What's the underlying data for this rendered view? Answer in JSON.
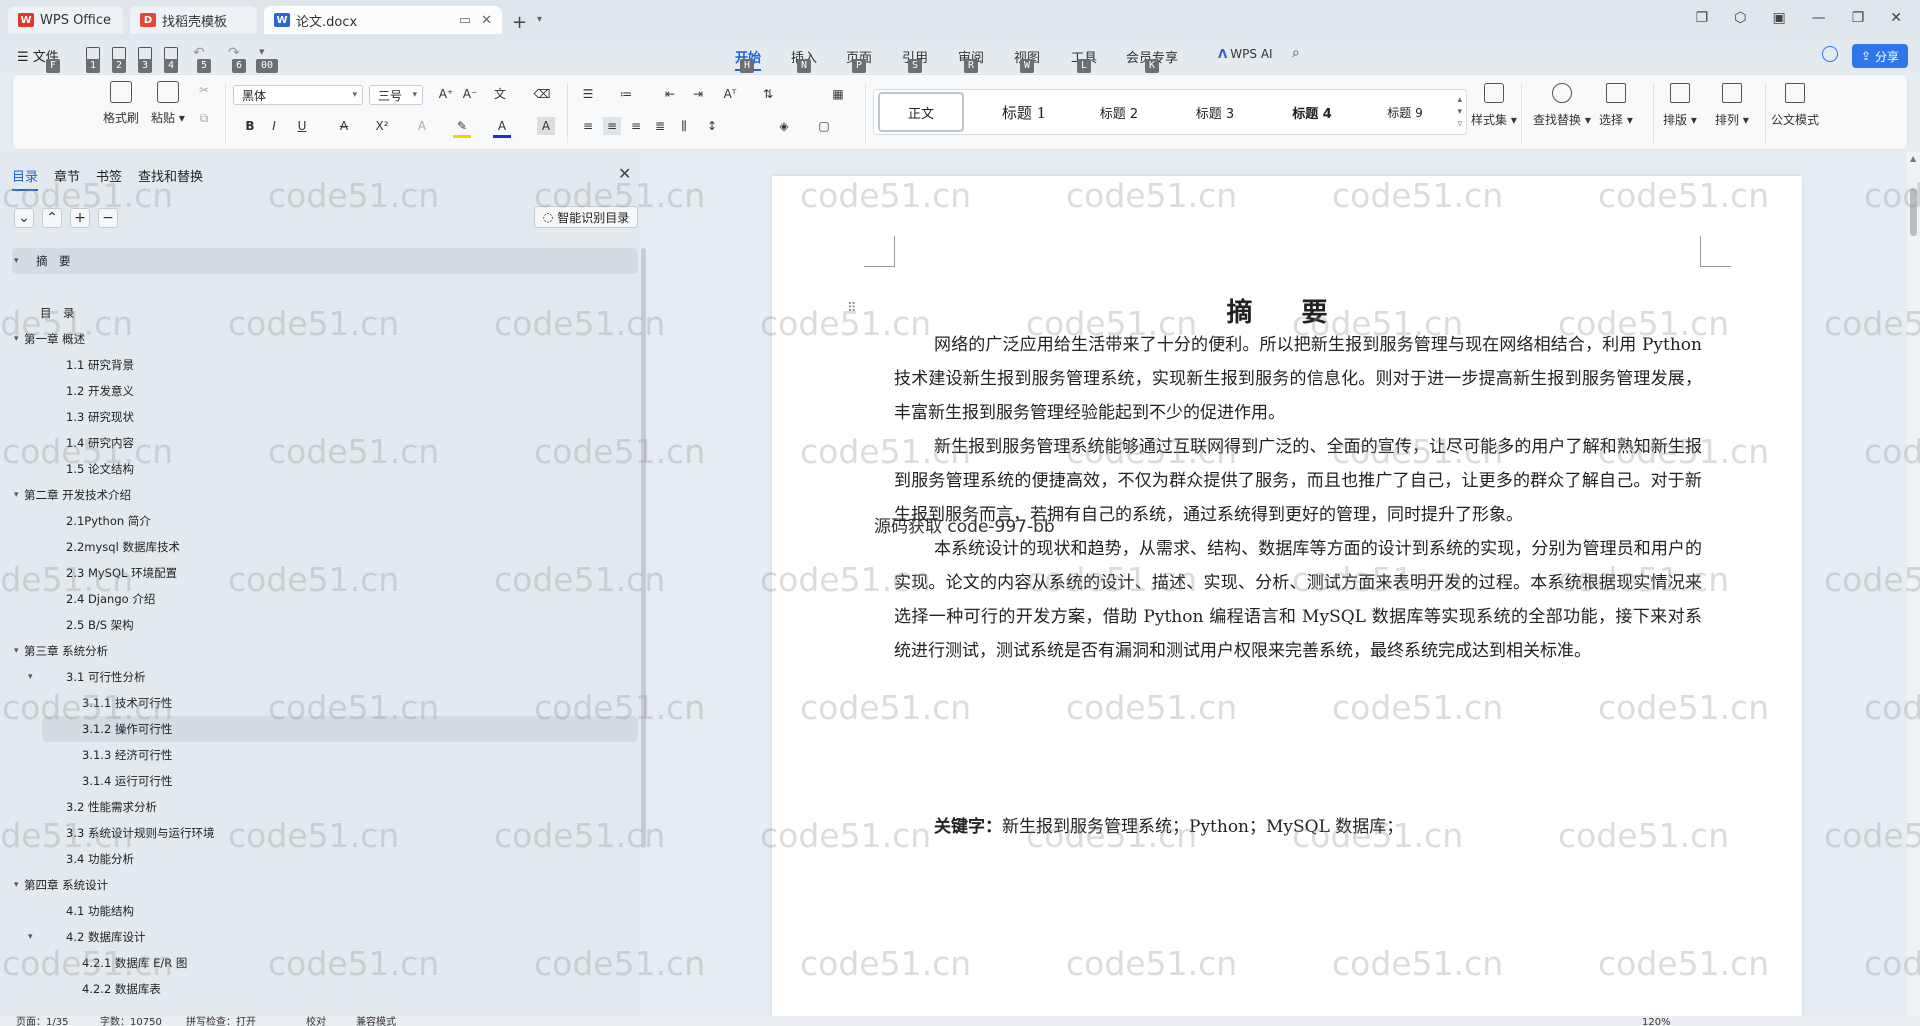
{
  "tabs": [
    {
      "label": "WPS Office",
      "icon": "wps-logo-icon"
    },
    {
      "label": "找稻壳模板",
      "icon": "docer-icon"
    },
    {
      "label": "论文.docx",
      "icon": "word-doc-icon"
    }
  ],
  "menu": {
    "file": "文件",
    "quick_keys": [
      "F",
      "1",
      "2",
      "3",
      "4",
      "5",
      "6",
      "00"
    ],
    "ribbon_tabs": [
      {
        "label": "开始",
        "key": "H"
      },
      {
        "label": "插入",
        "key": "N"
      },
      {
        "label": "页面",
        "key": "P"
      },
      {
        "label": "引用",
        "key": "S"
      },
      {
        "label": "审阅",
        "key": "R"
      },
      {
        "label": "视图",
        "key": "W"
      },
      {
        "label": "工具",
        "key": "L"
      },
      {
        "label": "会员专享",
        "key": "K"
      }
    ],
    "ai_label": "WPS AI",
    "share": "分享"
  },
  "ribbon": {
    "format_painter": "格式刷",
    "paste": "粘贴",
    "font_name": "黑体",
    "font_size": "三号",
    "styles": [
      "正文",
      "标题 1",
      "标题 2",
      "标题 3",
      "标题 4",
      "标题 9"
    ],
    "style_set": "样式集",
    "find_replace": "查找替换",
    "select": "选择",
    "layout": "排版",
    "arrange": "排列",
    "official_mode": "公文模式",
    "accent": "#1f63d6"
  },
  "nav": {
    "tabs": [
      "目录",
      "章节",
      "书签",
      "查找和替换"
    ],
    "smart_toc": "智能识别目录",
    "items": [
      {
        "label": "摘　要",
        "level": 0,
        "expand": true
      },
      {
        "label": "",
        "level": 0,
        "expand": false
      },
      {
        "label": "目　录",
        "level": 0,
        "expand": false
      },
      {
        "label": "第一章  概述",
        "level": 0,
        "expand": true
      },
      {
        "label": "1.1 研究背景",
        "level": 1,
        "expand": false
      },
      {
        "label": "1.2  开发意义",
        "level": 1,
        "expand": false
      },
      {
        "label": "1.3  研究现状",
        "level": 1,
        "expand": false
      },
      {
        "label": "1.4  研究内容",
        "level": 1,
        "expand": false
      },
      {
        "label": "1.5  论文结构",
        "level": 1,
        "expand": false
      },
      {
        "label": "第二章  开发技术介绍",
        "level": 0,
        "expand": true
      },
      {
        "label": "2.1Python 简介",
        "level": 1,
        "expand": false
      },
      {
        "label": "2.2mysql 数据库技术",
        "level": 1,
        "expand": false
      },
      {
        "label": "2.3 MySQL 环境配置",
        "level": 1,
        "expand": false
      },
      {
        "label": "2.4 Django 介绍",
        "level": 1,
        "expand": false
      },
      {
        "label": "2.5 B/S 架构",
        "level": 1,
        "expand": false
      },
      {
        "label": "第三章  系统分析",
        "level": 0,
        "expand": true
      },
      {
        "label": "3.1  可行性分析",
        "level": 1,
        "expand": true
      },
      {
        "label": "3.1.1 技术可行性",
        "level": 2,
        "expand": false
      },
      {
        "label": "3.1.2 操作可行性",
        "level": 2,
        "expand": false
      },
      {
        "label": "3.1.3  经济可行性",
        "level": 2,
        "expand": false
      },
      {
        "label": "3.1.4  运行可行性",
        "level": 2,
        "expand": false
      },
      {
        "label": "3.2 性能需求分析",
        "level": 1,
        "expand": false
      },
      {
        "label": "3.3 系统设计规则与运行环境",
        "level": 1,
        "expand": false
      },
      {
        "label": "3.4 功能分析",
        "level": 1,
        "expand": false
      },
      {
        "label": "第四章  系统设计",
        "level": 0,
        "expand": true
      },
      {
        "label": "4.1 功能结构",
        "level": 1,
        "expand": false
      },
      {
        "label": "4.2  数据库设计",
        "level": 1,
        "expand": true
      },
      {
        "label": "4.2.1  数据库 E/R 图",
        "level": 2,
        "expand": false
      },
      {
        "label": "4.2.2  数据库表",
        "level": 2,
        "expand": false
      }
    ]
  },
  "document": {
    "title": "摘  要",
    "paragraphs": [
      "网络的广泛应用给生活带来了十分的便利。所以把新生报到服务管理与现在网络相结合，利用 Python 技术建设新生报到服务管理系统，实现新生报到服务的信息化。则对于进一步提高新生报到服务管理发展，丰富新生报到服务管理经验能起到不少的促进作用。",
      "新生报到服务管理系统能够通过互联网得到广泛的、全面的宣传，让尽可能多的用户了解和熟知新生报到服务管理系统的便捷高效，不仅为群众提供了服务，而且也推广了自己，让更多的群众了解自己。对于新生报到服务而言，若拥有自己的系统，通过系统得到更好的管理，同时提升了形象。",
      "本系统设计的现状和趋势，从需求、结构、数据库等方面的设计到系统的实现，分别为管理员和用户的实现。论文的内容从系统的设计、描述、实现、分析、测试方面来表明开发的过程。本系统根据现实情况来选择一种可行的开发方案，借助 Python 编程语言和 MySQL 数据库等实现系统的全部功能，接下来对系统进行测试，测试系统是否有漏洞和测试用户权限来完善系统，最终系统完成达到相关标准。"
    ],
    "overlay_text": "源码获取 code-997-bb",
    "keywords_label": "关键字：",
    "keywords": "新生报到服务管理系统；Python；MySQL 数据库；"
  },
  "status": {
    "page": "页面：1/35",
    "words": "字数：10750",
    "spell": "拼写检查：打开",
    "proof": "校对",
    "compat": "兼容模式",
    "zoom": "120%"
  },
  "watermark": "code51.cn"
}
